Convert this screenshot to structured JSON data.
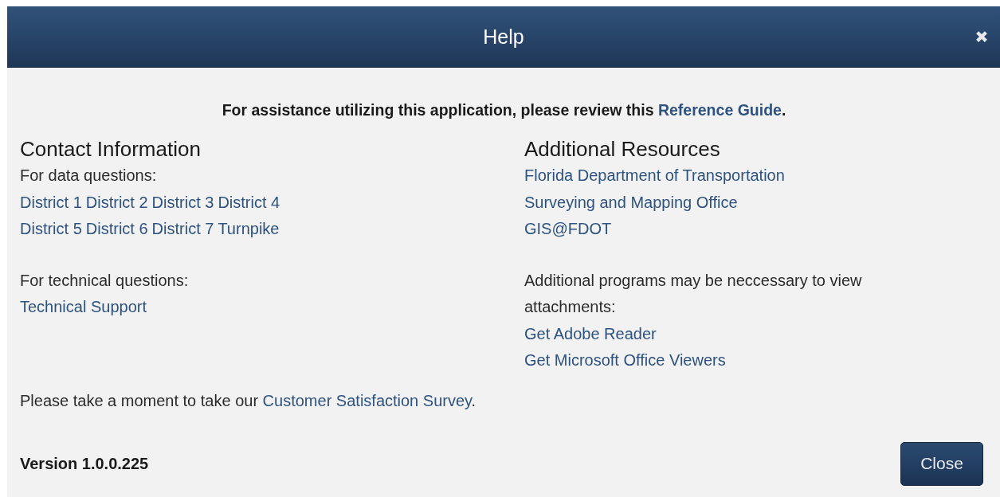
{
  "dialog": {
    "title": "Help"
  },
  "intro": {
    "before": "For assistance utilizing this application, please review this ",
    "link": "Reference Guide",
    "after": "."
  },
  "contact": {
    "heading": "Contact Information",
    "data_label": "For data questions:",
    "district_links": [
      [
        "District 1",
        "District 2",
        "District 3",
        "District 4"
      ],
      [
        "District 5",
        "District 6",
        "District 7",
        "Turnpike"
      ]
    ],
    "technical_label": "For technical questions:",
    "technical_link": "Technical Support"
  },
  "resources": {
    "heading": "Additional Resources",
    "links": [
      "Florida Department of Transportation",
      "Surveying and Mapping Office",
      "GIS@FDOT"
    ],
    "note": "Additional programs may be neccessary to view attachments:",
    "download_links": [
      "Get Adobe Reader",
      "Get Microsoft Office Viewers"
    ]
  },
  "survey": {
    "before": "Please take a moment to take our ",
    "link": "Customer Satisfaction Survey",
    "after": "."
  },
  "version": "Version 1.0.0.225",
  "close_button": "Close"
}
